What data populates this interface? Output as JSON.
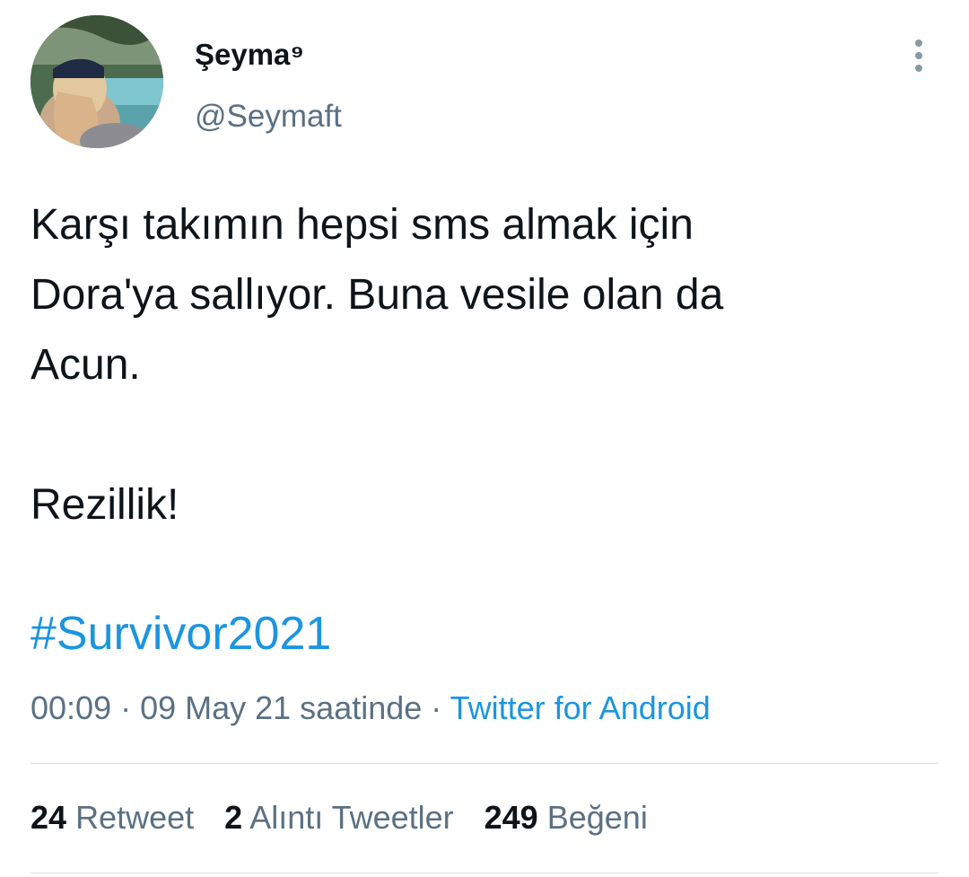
{
  "tweet": {
    "author": {
      "display_name": "Şeyma⁹",
      "handle": "@Seymaft"
    },
    "more_icon": "more-vertical-icon",
    "text_lines": [
      "Karşı takımın hepsi sms almak için",
      "Dora'ya sallıyor. Buna vesile olan da",
      "Acun.",
      "",
      "Rezillik!"
    ],
    "hashtag": "#Survivor2021",
    "timestamp": "00:09 · 09 May 21 saatinde",
    "separator": " · ",
    "source": "Twitter for Android",
    "stats": {
      "retweets": {
        "count": "24",
        "label": "Retweet"
      },
      "quotes": {
        "count": "2",
        "label": "Alıntı Tweetler"
      },
      "likes": {
        "count": "249",
        "label": "Beğeni"
      }
    },
    "colors": {
      "link": "#1b95e0",
      "secondary_text": "#5b7083",
      "primary_text": "#0f1419",
      "divider": "#d8dee3"
    }
  }
}
